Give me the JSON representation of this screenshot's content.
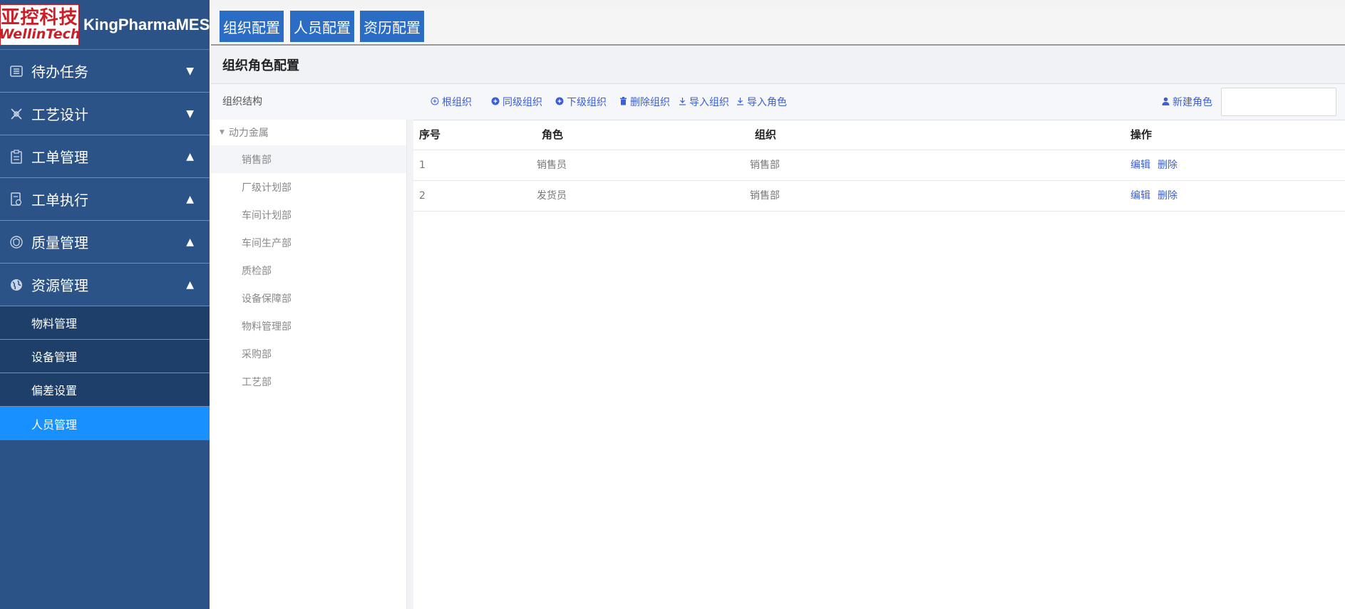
{
  "brand": {
    "logo_cn": "亚控科技",
    "logo_en": "WellinTech",
    "app_name": "KingPharmaMES"
  },
  "sidebar": {
    "groups": [
      {
        "label": "待办任务",
        "icon": "task-list-icon",
        "arrow": "▼"
      },
      {
        "label": "工艺设计",
        "icon": "design-tools-icon",
        "arrow": "▼"
      },
      {
        "label": "工单管理",
        "icon": "clipboard-icon",
        "arrow": "▲"
      },
      {
        "label": "工单执行",
        "icon": "execution-doc-icon",
        "arrow": "▲"
      },
      {
        "label": "质量管理",
        "icon": "quality-badge-icon",
        "arrow": "▲"
      },
      {
        "label": "资源管理",
        "icon": "globe-icon",
        "arrow": "▲"
      }
    ],
    "sub_items": [
      {
        "label": "物料管理",
        "active": false
      },
      {
        "label": "设备管理",
        "active": false
      },
      {
        "label": "偏差设置",
        "active": false
      },
      {
        "label": "人员管理",
        "active": true
      }
    ]
  },
  "tabs": [
    {
      "label": "组织配置"
    },
    {
      "label": "人员配置"
    },
    {
      "label": "资历配置"
    }
  ],
  "content": {
    "title": "组织角色配置"
  },
  "toolbar": {
    "org_label": "组织结构",
    "buttons": [
      {
        "label": "根组织",
        "icon": "circle-plus-outline-icon"
      },
      {
        "label": "同级组织",
        "icon": "circle-plus-icon"
      },
      {
        "label": "下级组织",
        "icon": "circle-plus-icon"
      },
      {
        "label": "删除组织",
        "icon": "trash-icon"
      },
      {
        "label": "导入组织",
        "icon": "import-icon"
      },
      {
        "label": "导入角色",
        "icon": "import-icon"
      }
    ],
    "new_role": {
      "label": "新建角色",
      "icon": "user-icon"
    },
    "search": {
      "value": "",
      "placeholder": ""
    }
  },
  "tree": {
    "root": "动力金属",
    "nodes": [
      {
        "label": "销售部",
        "selected": true
      },
      {
        "label": "厂级计划部",
        "selected": false
      },
      {
        "label": "车间计划部",
        "selected": false
      },
      {
        "label": "车间生产部",
        "selected": false
      },
      {
        "label": "质检部",
        "selected": false
      },
      {
        "label": "设备保障部",
        "selected": false
      },
      {
        "label": "物料管理部",
        "selected": false
      },
      {
        "label": "采购部",
        "selected": false
      },
      {
        "label": "工艺部",
        "selected": false
      }
    ]
  },
  "table": {
    "headers": {
      "seq": "序号",
      "role": "角色",
      "org": "组织",
      "ops": "操作"
    },
    "rows": [
      {
        "seq": "1",
        "role": "销售员",
        "org": "销售部",
        "edit": "编辑",
        "delete": "删除"
      },
      {
        "seq": "2",
        "role": "发货员",
        "org": "销售部",
        "edit": "编辑",
        "delete": "删除"
      }
    ]
  }
}
